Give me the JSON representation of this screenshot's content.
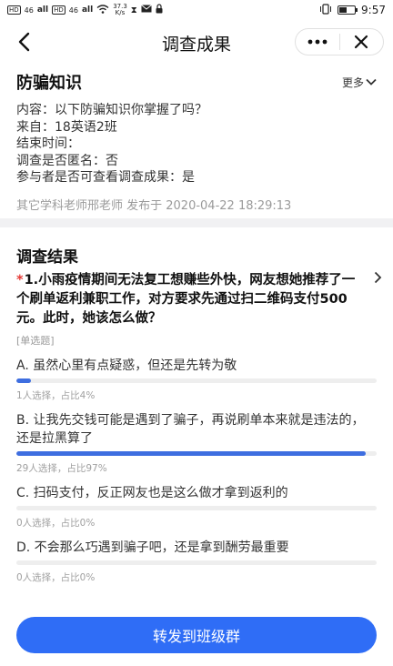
{
  "status_bar": {
    "sim1_chip": "HD",
    "sim1_network": "46",
    "sim1_signal": "all",
    "sim2_chip": "HD",
    "sim2_network": "46",
    "sim2_signal": "all",
    "speed_value": "37.3",
    "speed_unit": "K/s",
    "battery_level": "45%",
    "time": "9:57"
  },
  "nav": {
    "title": "调查成果",
    "more_label": "•••",
    "close_label": "✕"
  },
  "info": {
    "title": "防骗知识",
    "more_label": "更多",
    "lines": [
      "内容：以下防骗知识你掌握了吗？",
      "来自：18英语2班",
      "结束时间：",
      "调查是否匿名：否",
      "参与者是否可查看调查成果：是"
    ],
    "publisher": "其它学科老师邢老师 发布于 2020-04-22 18:29:13"
  },
  "results": {
    "title": "调查结果",
    "required_mark": "*",
    "question": "1.小雨疫情期间无法复工想赚些外快，网友想她推荐了一个刷单返利兼职工作，对方要求先通过扫二维码支付500元。此时，她该怎么做？",
    "question_type": "[单选题]",
    "options": [
      {
        "text": "A. 虽然心里有点疑惑，但还是先转为敬",
        "stat": "1人选择，占比4%",
        "percent": 4
      },
      {
        "text": "B. 让我先交钱可能是遇到了骗子，再说刷单本来就是违法的，还是拉黑算了",
        "stat": "29人选择，占比97%",
        "percent": 97
      },
      {
        "text": "C. 扫码支付，反正网友也是这么做才拿到返利的",
        "stat": "0人选择，占比0%",
        "percent": 0
      },
      {
        "text": "D. 不会那么巧遇到骗子吧，还是拿到酬劳最重要",
        "stat": "0人选择，占比0%",
        "percent": 0
      }
    ]
  },
  "share_button": {
    "label": "转发到班级群"
  },
  "colors": {
    "accent": "#2f6df6",
    "bar_fill": "#3e6ee0",
    "required": "#e53935"
  },
  "icons": [
    "back-arrow-icon",
    "more-dots-icon",
    "close-icon",
    "chevron-down-icon",
    "chevron-right-icon",
    "wifi-icon",
    "battery-icon",
    "vibrate-icon",
    "lock-icon",
    "mail-icon"
  ]
}
